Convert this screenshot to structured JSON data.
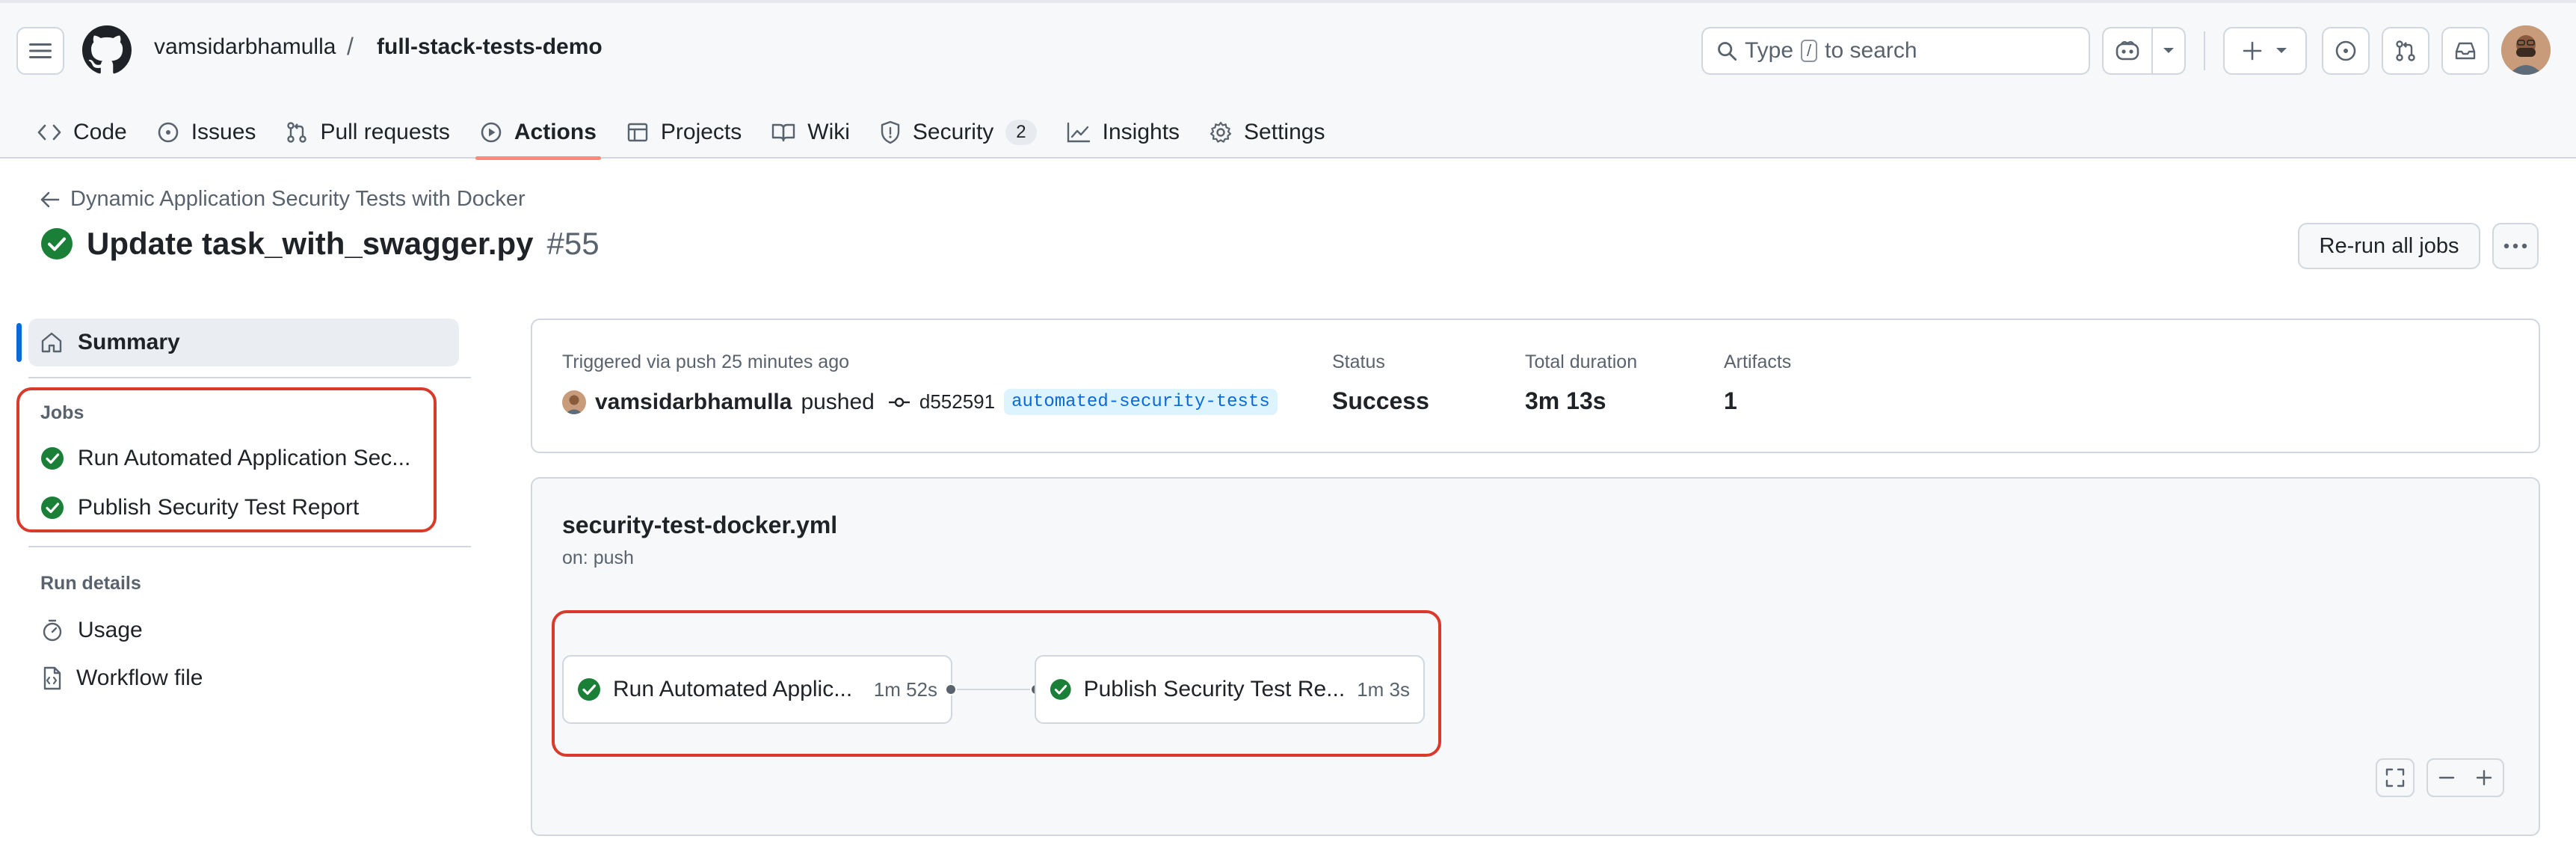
{
  "header": {
    "owner": "vamsidarbhamulla",
    "separator": "/",
    "repo": "full-stack-tests-demo",
    "search_prefix": "Type",
    "search_key": "/",
    "search_suffix": "to search"
  },
  "tabs": [
    {
      "label": "Code",
      "icon": "code-icon"
    },
    {
      "label": "Issues",
      "icon": "issue-icon"
    },
    {
      "label": "Pull requests",
      "icon": "pull-request-icon"
    },
    {
      "label": "Actions",
      "icon": "play-icon",
      "active": true
    },
    {
      "label": "Projects",
      "icon": "table-icon"
    },
    {
      "label": "Wiki",
      "icon": "book-icon"
    },
    {
      "label": "Security",
      "icon": "shield-icon",
      "counter": "2"
    },
    {
      "label": "Insights",
      "icon": "graph-icon"
    },
    {
      "label": "Settings",
      "icon": "gear-icon"
    }
  ],
  "run": {
    "workflow_name": "Dynamic Application Security Tests with Docker",
    "title": "Update task_with_swagger.py",
    "number": "#55",
    "rerun_label": "Re-run all jobs"
  },
  "sidebar": {
    "summary_label": "Summary",
    "jobs_heading": "Jobs",
    "jobs": [
      {
        "label": "Run Automated Application Sec..."
      },
      {
        "label": "Publish Security Test Report"
      }
    ],
    "run_details_heading": "Run details",
    "details": [
      {
        "label": "Usage",
        "icon": "stopwatch-icon"
      },
      {
        "label": "Workflow file",
        "icon": "file-code-icon"
      }
    ]
  },
  "summary": {
    "trigger_text": "Triggered via push 25 minutes ago",
    "actor": "vamsidarbhamulla",
    "action": "pushed",
    "commit": "d552591",
    "branch": "automated-security-tests",
    "status_label": "Status",
    "status_value": "Success",
    "duration_label": "Total duration",
    "duration_value": "3m 13s",
    "artifacts_label": "Artifacts",
    "artifacts_value": "1"
  },
  "workflow": {
    "file": "security-test-docker.yml",
    "trigger": "on: push",
    "jobs": [
      {
        "name": "Run Automated Applic...",
        "duration": "1m 52s"
      },
      {
        "name": "Publish Security Test Re...",
        "duration": "1m 3s"
      }
    ]
  },
  "colors": {
    "success": "#1a7f37",
    "accent": "#0969da",
    "active_tab_underline": "#fd8c73",
    "annotation_box": "#d93a2b"
  }
}
